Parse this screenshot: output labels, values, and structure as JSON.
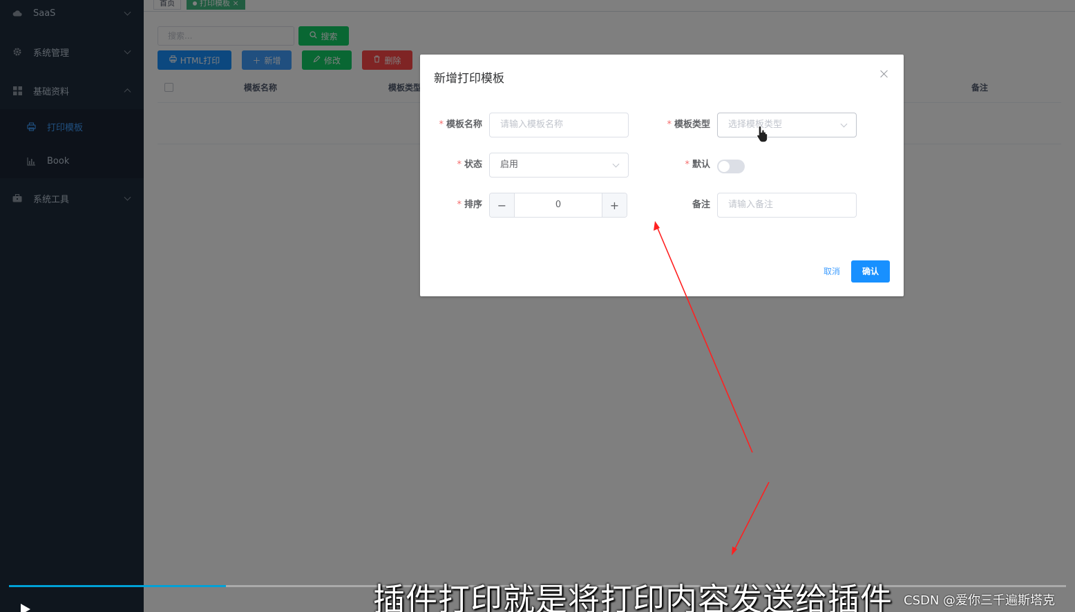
{
  "sidebar": {
    "items": [
      {
        "label": "SaaS",
        "icon": "cloud-icon"
      },
      {
        "label": "系统管理",
        "icon": "gear-icon"
      },
      {
        "label": "基础资料",
        "icon": "grid-icon"
      },
      {
        "label": "系统工具",
        "icon": "toolbox-icon"
      }
    ],
    "subitems": [
      {
        "label": "打印模板",
        "icon": "printer-icon",
        "active": true
      },
      {
        "label": "Book",
        "icon": "chart-icon"
      }
    ]
  },
  "tags": {
    "home": "首页",
    "active": "打印模板"
  },
  "toolbar": {
    "search_placeholder": "搜索...",
    "search_label": "搜索",
    "html_print_label": "HTML打印",
    "add_label": "新增",
    "edit_label": "修改",
    "delete_label": "删除"
  },
  "table": {
    "columns": [
      "模板名称",
      "模板类型",
      "备注"
    ]
  },
  "dialog": {
    "title": "新增打印模板",
    "fields": {
      "name": {
        "label": "模板名称",
        "placeholder": "请输入模板名称"
      },
      "type": {
        "label": "模板类型",
        "placeholder": "选择模板类型"
      },
      "status": {
        "label": "状态",
        "value": "启用"
      },
      "default": {
        "label": "默认",
        "on": false
      },
      "sort": {
        "label": "排序",
        "value": "0"
      },
      "remark": {
        "label": "备注",
        "placeholder": "请输入备注"
      }
    },
    "required_mark": "*",
    "cancel_label": "取消",
    "ok_label": "确认"
  },
  "video": {
    "subtitle": "插件打印就是将打印内容发送给插件",
    "watermark": "CSDN @爱你三千遍斯塔克",
    "progress": 0.205
  },
  "colors": {
    "sidebar_bg": "#1f2d3d",
    "primary": "#1890ff",
    "success": "#13ce66",
    "danger": "#ff4949",
    "annotation_arrow": "#ff2020"
  }
}
